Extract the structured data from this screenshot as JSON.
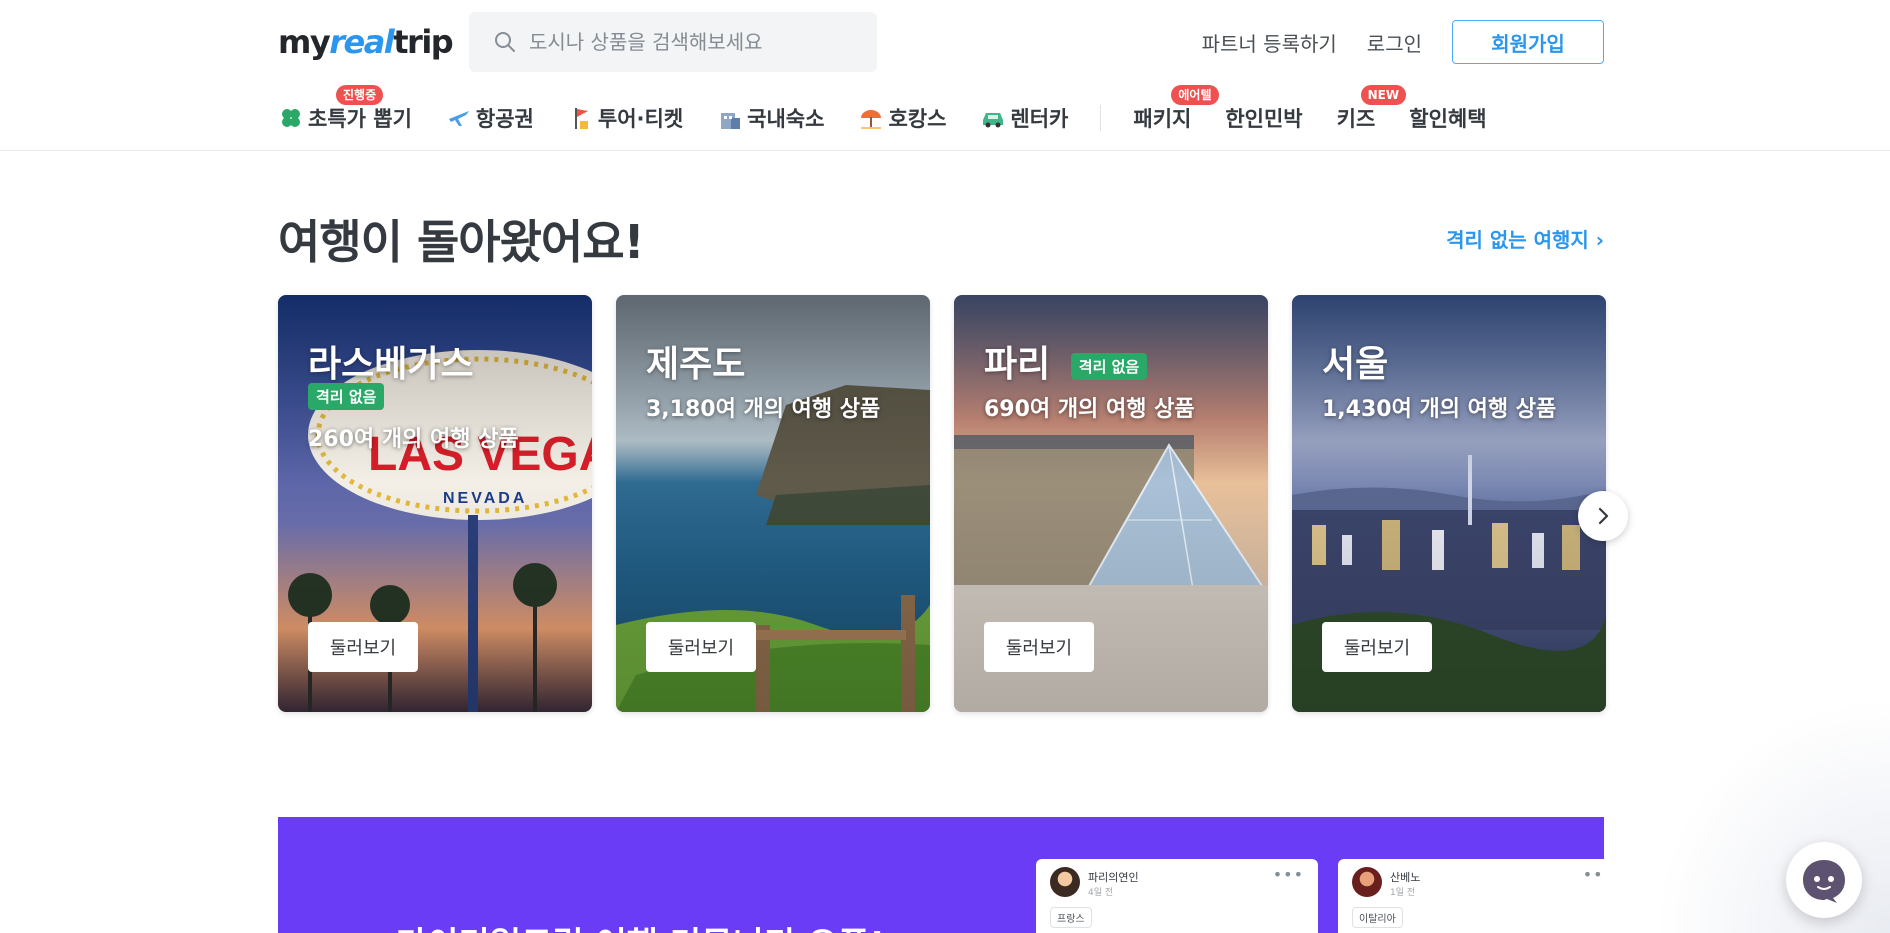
{
  "header": {
    "logo": {
      "prefix": "my",
      "highlight": "real",
      "suffix": "trip"
    },
    "search": {
      "placeholder": "도시나 상품을 검색해보세요"
    },
    "links": {
      "partner": "파트너 등록하기",
      "login": "로그인",
      "signup": "회원가입"
    }
  },
  "nav": {
    "items": [
      {
        "label": "초특가 뽑기",
        "badge": "진행중",
        "icon": "clover-icon"
      },
      {
        "label": "항공권",
        "icon": "airplane-icon"
      },
      {
        "label": "투어·티켓",
        "icon": "flag-icon"
      },
      {
        "label": "국내숙소",
        "icon": "hotel-icon"
      },
      {
        "label": "호캉스",
        "icon": "beach-umbrella-icon"
      },
      {
        "label": "렌터카",
        "icon": "car-icon"
      },
      {
        "label": "패키지",
        "badge": "에어텔"
      },
      {
        "label": "한인민박"
      },
      {
        "label": "키즈",
        "badge": "NEW"
      },
      {
        "label": "할인혜택"
      }
    ]
  },
  "section": {
    "title": "여행이 돌아왔어요!",
    "link": "격리 없는 여행지 ›"
  },
  "cards": [
    {
      "name": "라스베가스",
      "tag": "격리 없음",
      "count": "260여 개의 여행 상품",
      "button": "둘러보기"
    },
    {
      "name": "제주도",
      "count": "3,180여 개의 여행 상품",
      "button": "둘러보기"
    },
    {
      "name": "파리",
      "tag": "격리 없음",
      "count": "690여 개의 여행 상품",
      "button": "둘러보기"
    },
    {
      "name": "서울",
      "count": "1,430여 개의 여행 상품",
      "button": "둘러보기"
    }
  ],
  "banner": {
    "title": "마이리얼트립 여행 커뮤니티 오픈!",
    "posts": [
      {
        "author": "파리의연인",
        "time": "4일 전",
        "category": "프랑스"
      },
      {
        "author": "산베노",
        "time": "1일 전",
        "category": "이탈리아"
      }
    ]
  },
  "colors": {
    "accent": "#2b96ed",
    "badge": "#ef5050",
    "tag": "#2aa868",
    "banner": "#6a3cf6"
  }
}
